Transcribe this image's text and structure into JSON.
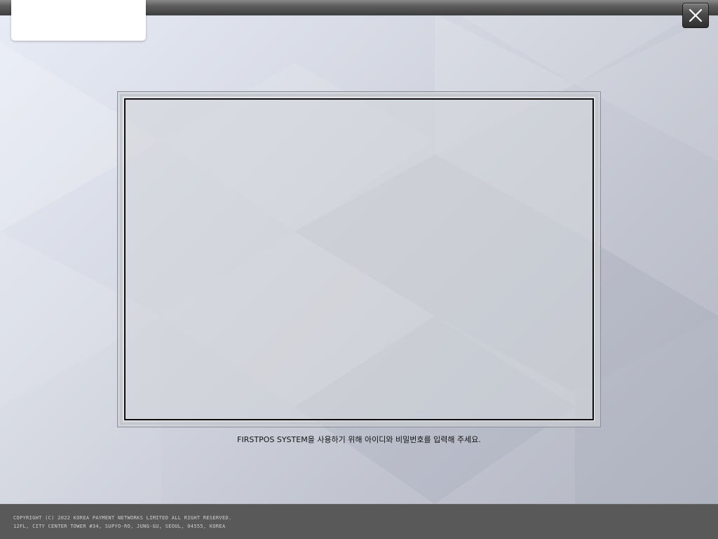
{
  "window": {
    "close_icon": "close-icon"
  },
  "login": {
    "instruction": "FIRSTPOS SYSTEM을 사용하기 위해 아이디와 비밀번호를 입력해 주세요."
  },
  "footer": {
    "copyright": "COPYRIGHT (C) 2022 KOREA PAYMENT NETWORKS LIMITED ALL RIGHT RESERVED.",
    "address": "12FL, CITY CENTER TOWER #34, SUPYO-RO, JUNG-GU, SEOUL, 04555, KOREA"
  },
  "colors": {
    "top_bar": "#4a4a4a",
    "footer": "#595959",
    "background": "#d6d9e3",
    "frame_border": "#0a0a0a"
  }
}
